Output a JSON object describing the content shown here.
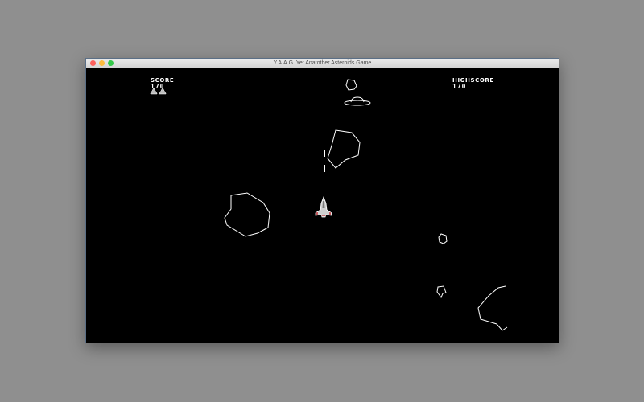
{
  "window": {
    "title": "Y.A.A.G. Yet Anatother Asteroids Game",
    "buttons": {
      "close_color": "#fc605c",
      "minimize_color": "#fdbc40",
      "zoom_color": "#34c84a"
    }
  },
  "hud": {
    "score_label": "SCORE",
    "score_value": "170",
    "highscore_label": "HIGHSCORE",
    "highscore_value": "170",
    "lives_remaining": 2
  },
  "colors": {
    "background": "#000000",
    "vector_stroke": "#ffffff",
    "ship_accent": "#c0272d"
  },
  "icons": {
    "life": "ship-life-icon",
    "player": "player-ship-icon",
    "ufo": "ufo-icon"
  }
}
